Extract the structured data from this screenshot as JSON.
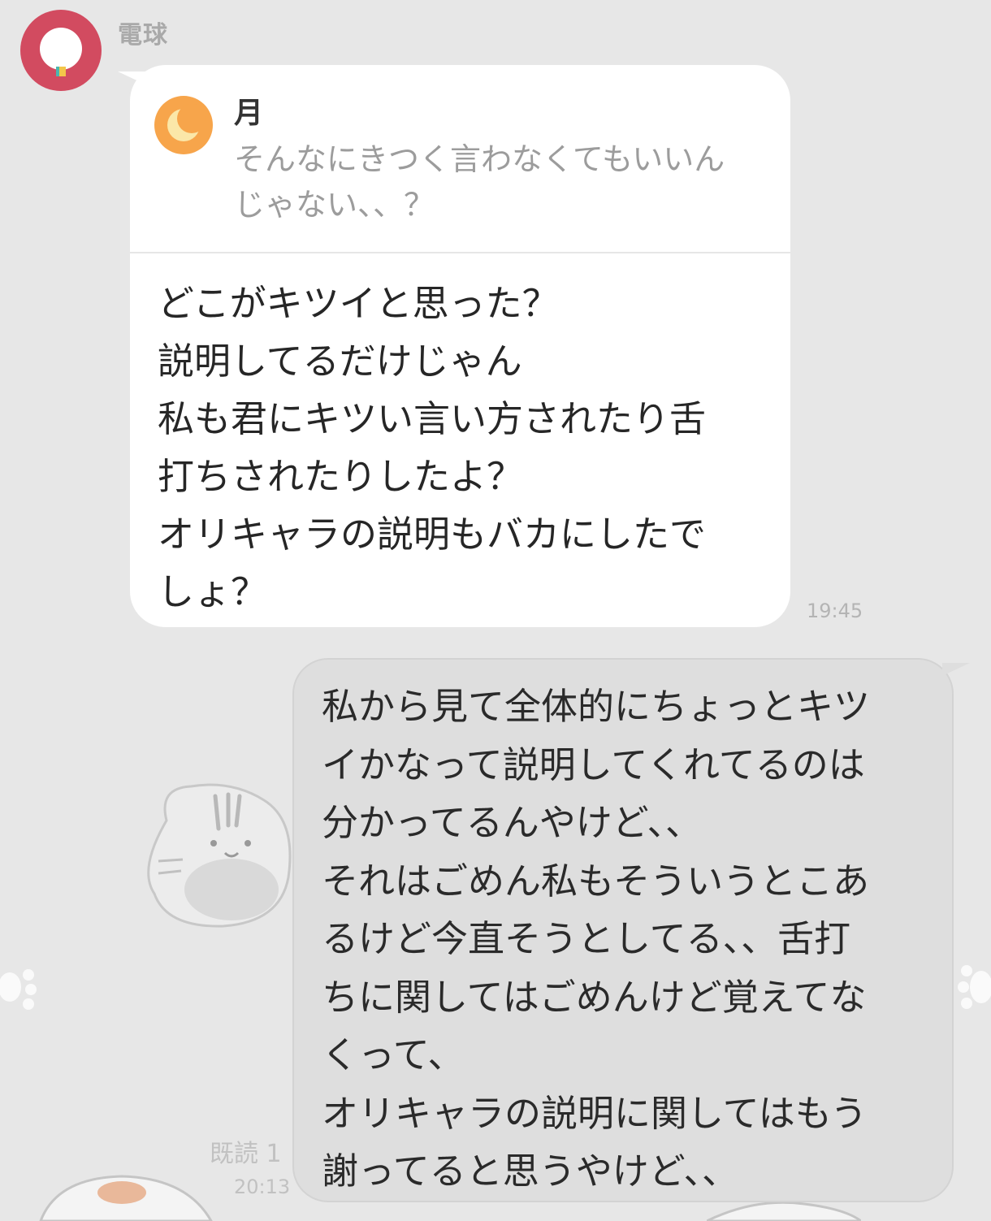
{
  "incoming": {
    "sender_name": "電球",
    "avatar_icon": "lightbulb-icon",
    "reply_quote": {
      "name": "月",
      "avatar_icon": "crescent-moon-icon",
      "text": "そんなにきつく言わなくてもいいん\nじゃない、、？"
    },
    "message": "どこがキツイと思った？\n説明してるだけじゃん\n私も君にキツい言い方されたり舌\n打ちされたりしたよ？\nオリキャラの説明もバカにしたで\nしょ？",
    "time": "19:45"
  },
  "outgoing": {
    "message": "私から見て全体的にちょっとキツ\nイかなって説明してくれてるのは\n分かってるんやけど、、\nそれはごめん私もそういうとこあ\nるけど今直そうとしてる、、舌打\nちに関してはごめんけど覚えてな\nくって、\nオリキャラの説明に関してはもう\n謝ってると思うやけど、、",
    "read_status": "既読 1",
    "time": "20:13"
  },
  "colors": {
    "background": "#e7e7e7",
    "avatar": "#d24b60",
    "quote_avatar": "#f7a54b",
    "bubble_in": "#ffffff",
    "bubble_out": "#dedede"
  }
}
